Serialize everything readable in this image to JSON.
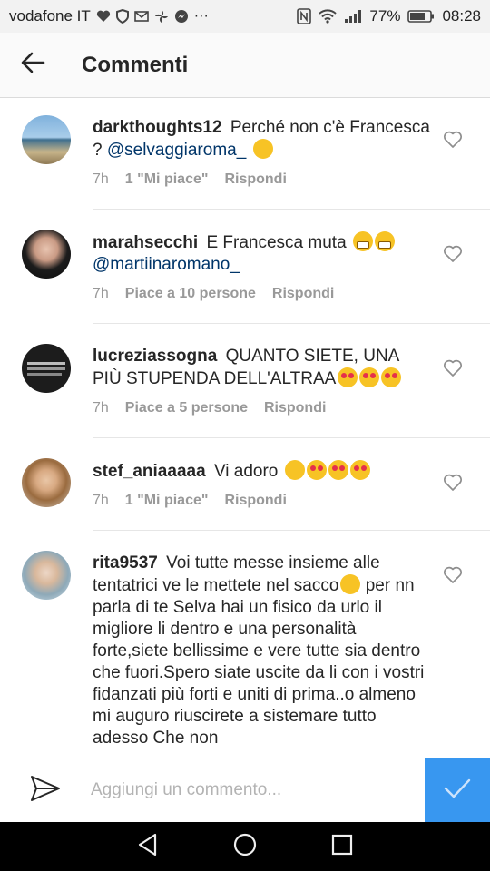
{
  "status_bar": {
    "carrier": "vodafone IT",
    "battery": "77%",
    "time": "08:28"
  },
  "header": {
    "title": "Commenti"
  },
  "comments": [
    {
      "username": "darkthoughts12",
      "text": "Perché non c'è Francesca ?",
      "mention": "@selvaggiaroma_",
      "time": "7h",
      "likes": "1 \"Mi piace\"",
      "reply": "Rispondi"
    },
    {
      "username": "marahsecchi",
      "text": "E Francesca muta",
      "mention": "@martiinaromano_",
      "time": "7h",
      "likes": "Piace a 10 persone",
      "reply": "Rispondi"
    },
    {
      "username": "lucreziassogna",
      "text": "QUANTO SIETE, UNA PIÙ STUPENDA DELL'ALTRAA",
      "time": "7h",
      "likes": "Piace a 5 persone",
      "reply": "Rispondi"
    },
    {
      "username": "stef_aniaaaaa",
      "text": "Vi adoro",
      "time": "7h",
      "likes": "1 \"Mi piace\"",
      "reply": "Rispondi"
    },
    {
      "username": "rita9537",
      "text": "Voi tutte messe insieme alle tentatrici ve le mettete nel sacco",
      "text2": "per nn parla di te Selva hai un fisico da urlo il migliore li dentro e una personalità forte,siete bellissime e vere tutte sia dentro che fuori.Spero siate uscite da li con i vostri fidanzati più forti e uniti di prima..o almeno mi auguro riuscirete a sistemare tutto adesso Che non"
    }
  ],
  "input": {
    "placeholder": "Aggiungi un commento..."
  },
  "icons": {
    "back": "arrow-left-icon",
    "like": "heart-outline-icon",
    "send": "paper-plane-icon",
    "post": "checkmark-icon"
  },
  "colors": {
    "accent": "#3897f0",
    "mention": "#003569",
    "meta": "#999999"
  }
}
